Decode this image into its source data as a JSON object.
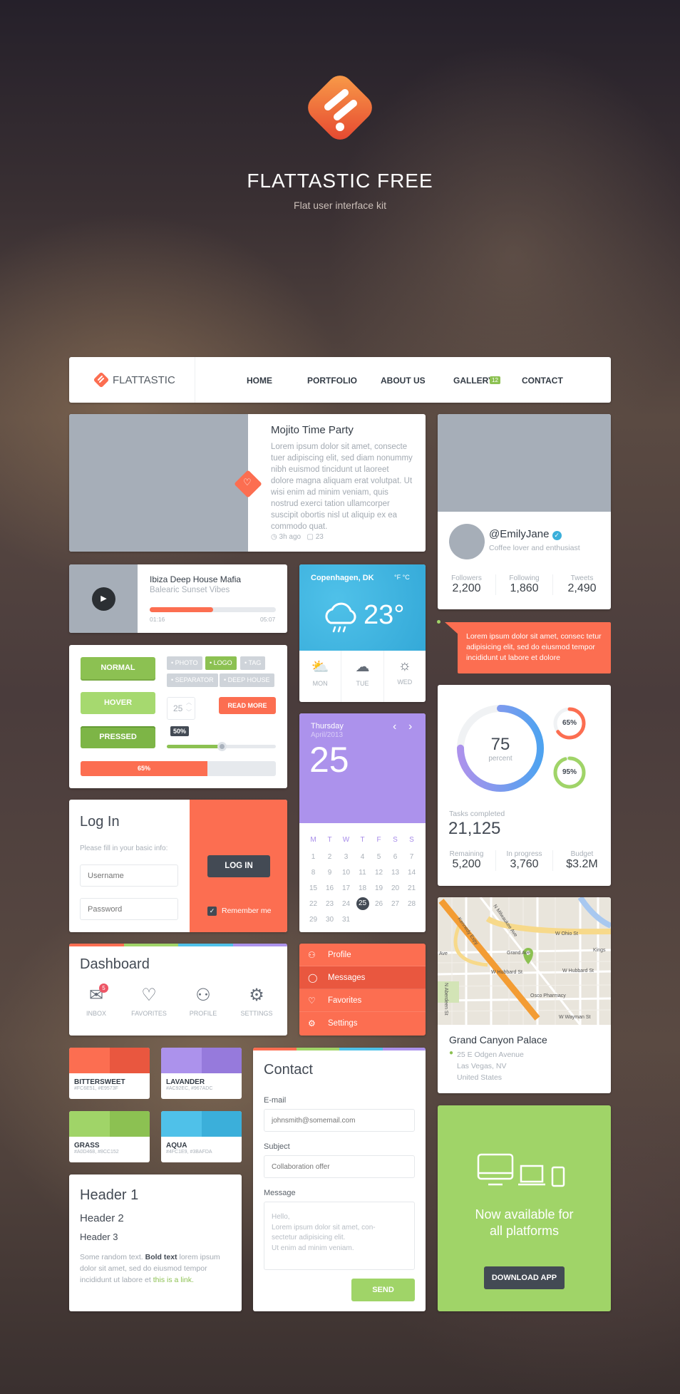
{
  "hero": {
    "title": "FLATTASTIC FREE",
    "subtitle": "Flat user interface kit",
    "logo_icon": "flattastic-logo"
  },
  "navbar": {
    "brand": "FLATTASTIC",
    "items": [
      {
        "label": "HOME"
      },
      {
        "label": "PORTFOLIO"
      },
      {
        "label": "ABOUT US"
      },
      {
        "label": "GALLERY",
        "badge": "12"
      },
      {
        "label": "CONTACT"
      }
    ]
  },
  "blog": {
    "title": "Mojito Time Party",
    "body": "Lorem ipsum dolor sit amet, consecte tuer adipiscing elit, sed diam nonummy nibh euismod tincidunt ut laoreet dolore magna aliquam erat volutpat. Ut wisi enim ad minim veniam, quis nostrud exerci tation ullamcorper suscipit obortis nisl ut aliquip ex ea commodo quat.",
    "time": "3h ago",
    "comments": "23"
  },
  "profile": {
    "handle": "@EmilyJane",
    "bio": "Coffee lover and enthusiast",
    "stats": [
      {
        "label": "Followers",
        "value": "2,200"
      },
      {
        "label": "Following",
        "value": "1,860"
      },
      {
        "label": "Tweets",
        "value": "2,490"
      }
    ]
  },
  "music": {
    "title": "Ibiza Deep House Mafia",
    "subtitle": "Balearic Sunset Vibes",
    "elapsed": "01:16",
    "duration": "05:07",
    "progress": 0.5
  },
  "weather": {
    "location": "Copenhagen, DK",
    "units": "°F °C",
    "temp": "23°",
    "days": [
      {
        "label": "MON",
        "icon": "partly-sunny-icon"
      },
      {
        "label": "TUE",
        "icon": "cloud-icon"
      },
      {
        "label": "WED",
        "icon": "sun-icon"
      }
    ]
  },
  "tooltip": {
    "text": "Lorem ipsum dolor sit amet, consec tetur adipisicing elit, sed do eiusmod tempor incididunt ut labore et dolore"
  },
  "controls": {
    "normal": "NORMAL",
    "hover": "HOVER",
    "pressed": "PRESSED",
    "tags": [
      {
        "label": "PHOTO",
        "active": false
      },
      {
        "label": "LOGO",
        "active": true
      },
      {
        "label": "TAG",
        "active": false
      },
      {
        "label": "SEPARATOR",
        "active": false
      },
      {
        "label": "DEEP HOUSE",
        "active": false
      }
    ],
    "stepper_value": "25",
    "read_more": "READ MORE",
    "slider_label": "50%",
    "slider_value": 0.5,
    "progress_label": "65%",
    "progress_value": 0.65
  },
  "calendar": {
    "weekday": "Thursday",
    "month": "April/2013",
    "day": "25",
    "headers": [
      "M",
      "T",
      "W",
      "T",
      "F",
      "S",
      "S"
    ],
    "weeks": [
      [
        "1",
        "2",
        "3",
        "4",
        "5",
        "6",
        "7"
      ],
      [
        "8",
        "9",
        "10",
        "11",
        "12",
        "13",
        "14"
      ],
      [
        "15",
        "16",
        "17",
        "18",
        "19",
        "20",
        "21"
      ],
      [
        "22",
        "23",
        "24",
        "25",
        "26",
        "27",
        "28"
      ],
      [
        "29",
        "30",
        "31",
        "",
        "",
        "",
        ""
      ]
    ],
    "selected": "25"
  },
  "stats": {
    "ring_value": "75",
    "ring_unit": "percent",
    "ring_fraction": 0.75,
    "small": [
      {
        "label": "65%",
        "value": 0.65,
        "color": "#fc6e51"
      },
      {
        "label": "95%",
        "value": 0.95,
        "color": "#a0d468"
      }
    ],
    "tasks_label": "Tasks completed",
    "tasks_value": "21,125",
    "row": [
      {
        "label": "Remaining",
        "value": "5,200"
      },
      {
        "label": "In progress",
        "value": "3,760"
      },
      {
        "label": "Budget",
        "value": "$3.2M"
      }
    ]
  },
  "login": {
    "title": "Log In",
    "hint": "Please fill in your basic info:",
    "username_placeholder": "Username",
    "password_placeholder": "Password",
    "button": "LOG IN",
    "remember": "Remember me",
    "remember_checked": true
  },
  "map": {
    "labels": [
      "N Milwaukee Ave",
      "Kennedy Expy",
      "W Ohio St",
      "Kings",
      "Ave",
      "Grand Ave",
      "W Hubbard St",
      "W Hubbard St",
      "Osco Pharmacy",
      "N Aberdeen St",
      "W Wayman St"
    ],
    "place": "Grand Canyon Palace",
    "address": [
      "25 E Odgen Avenue",
      "Las Vegas, NV",
      "United States"
    ]
  },
  "dashboard": {
    "title": "Dashboard",
    "items": [
      {
        "label": "INBOX",
        "icon": "mail-icon",
        "badge": "5"
      },
      {
        "label": "FAVORITES",
        "icon": "heart-icon"
      },
      {
        "label": "PROFILE",
        "icon": "user-icon"
      },
      {
        "label": "SETTINGS",
        "icon": "gear-icon"
      }
    ]
  },
  "menu": {
    "items": [
      {
        "label": "Profile",
        "icon": "user-icon"
      },
      {
        "label": "Messages",
        "icon": "chat-icon",
        "active": true
      },
      {
        "label": "Favorites",
        "icon": "heart-icon"
      },
      {
        "label": "Settings",
        "icon": "gear-icon"
      }
    ]
  },
  "swatches": [
    {
      "name": "BITTERSWEET",
      "hex": "#FC6E51, #E9573F",
      "c1": "#fc6e51",
      "c2": "#e9573f"
    },
    {
      "name": "LAVANDER",
      "hex": "#AC92EC, #967ADC",
      "c1": "#ac92ec",
      "c2": "#967adc"
    },
    {
      "name": "GRASS",
      "hex": "#A0D468, #8CC152",
      "c1": "#a0d468",
      "c2": "#8cc152"
    },
    {
      "name": "AQUA",
      "hex": "#4FC1E9, #3BAFDA",
      "c1": "#4fc1e9",
      "c2": "#3bafda"
    }
  ],
  "typography": {
    "h1": "Header 1",
    "h2": "Header 2",
    "h3": "Header 3",
    "text1": "Some random text.",
    "bold": "Bold text",
    "text2": "lorem ipsum dolor sit amet, sed do eiusmod tempor incididunt ut labore et",
    "link": "this is a link."
  },
  "contact": {
    "title": "Contact",
    "email_label": "E-mail",
    "email_placeholder": "johnsmith@somemail.com",
    "subject_label": "Subject",
    "subject_placeholder": "Collaboration offer",
    "message_label": "Message",
    "message_lines": [
      "Hello,",
      "Lorem ipsum dolor sit amet, con-",
      "sectetur adipisicing elit.",
      "Ut enim ad minim veniam."
    ],
    "send": "SEND"
  },
  "app": {
    "headline_1": "Now available for",
    "headline_2": "all platforms",
    "button": "DOWNLOAD APP"
  },
  "colors": {
    "orange": "#fc6e51",
    "green": "#a0d468",
    "blue": "#3bafda",
    "purple": "#ac92ec",
    "dark": "#434a54"
  }
}
